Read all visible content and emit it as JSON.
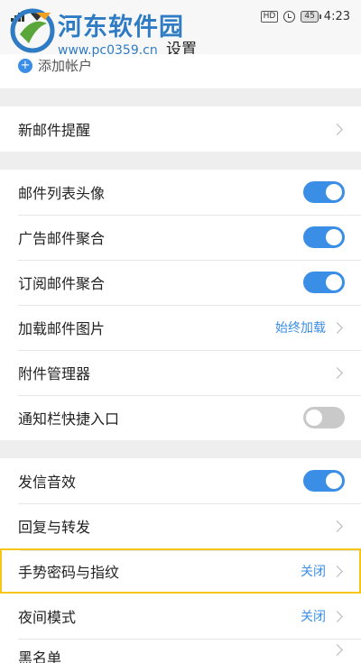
{
  "status_bar": {
    "hd": "HD",
    "battery": "45",
    "time": "4:23"
  },
  "header": {
    "title": "设置"
  },
  "watermark": {
    "name": "河东软件园",
    "url": "www.pc0359.cn"
  },
  "partial_row": {
    "label": "添加帐户"
  },
  "sections": [
    {
      "rows": [
        {
          "label": "新邮件提醒",
          "type": "link"
        }
      ]
    },
    {
      "rows": [
        {
          "label": "邮件列表头像",
          "type": "toggle",
          "on": true
        },
        {
          "label": "广告邮件聚合",
          "type": "toggle",
          "on": true
        },
        {
          "label": "订阅邮件聚合",
          "type": "toggle",
          "on": true
        },
        {
          "label": "加载邮件图片",
          "type": "link",
          "value": "始终加载"
        },
        {
          "label": "附件管理器",
          "type": "link"
        },
        {
          "label": "通知栏快捷入口",
          "type": "toggle",
          "on": false
        }
      ]
    },
    {
      "rows": [
        {
          "label": "发信音效",
          "type": "toggle",
          "on": true
        },
        {
          "label": "回复与转发",
          "type": "link"
        },
        {
          "label": "手势密码与指纹",
          "type": "link",
          "value": "关闭"
        },
        {
          "label": "夜间模式",
          "type": "link",
          "value": "关闭"
        },
        {
          "label": "黑名单",
          "type": "link"
        }
      ]
    }
  ],
  "colors": {
    "accent": "#3a8ee6",
    "highlight_border": "#f5c518",
    "watermark": "#2f7cc4"
  },
  "icons": {
    "chevron": "chevron-right-icon",
    "signal": "signal-icon",
    "wifi": "wifi-icon",
    "alarm": "alarm-icon",
    "battery": "battery-icon"
  }
}
